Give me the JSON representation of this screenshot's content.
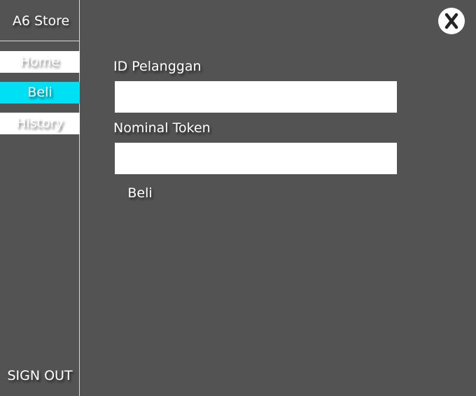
{
  "sidebar": {
    "brand": "A6 Store",
    "items": [
      {
        "label": "Home",
        "active": false
      },
      {
        "label": "Beli",
        "active": true
      },
      {
        "label": "History",
        "active": false
      }
    ],
    "signout_label": "SIGN OUT"
  },
  "header": {
    "close_icon": "x-icon"
  },
  "form": {
    "id_label": "ID Pelanggan",
    "id_value": "",
    "nominal_label": "Nominal Token",
    "nominal_value": "",
    "submit_label": "Beli"
  },
  "colors": {
    "background": "#535353",
    "accent": "#00e0f5",
    "text": "#ffffff"
  }
}
